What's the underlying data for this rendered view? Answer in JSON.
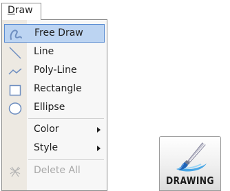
{
  "menu": {
    "title_accel": "D",
    "title_rest": "raw",
    "items": [
      {
        "label": "Free Draw",
        "icon": "free-draw-icon",
        "selected": true
      },
      {
        "label": "Line",
        "icon": "line-icon"
      },
      {
        "label": "Poly-Line",
        "icon": "polyline-icon"
      },
      {
        "label": "Rectangle",
        "icon": "rectangle-icon"
      },
      {
        "label": "Ellipse",
        "icon": "ellipse-icon"
      },
      {
        "label": "Color",
        "submenu": true
      },
      {
        "label": "Style",
        "submenu": true
      },
      {
        "label": "Delete All",
        "icon": "delete-all-icon",
        "disabled": true
      }
    ]
  },
  "toolbar": {
    "drawing_label": "DRAWING",
    "icon": "paintbrush-icon"
  },
  "colors": {
    "selection_fill": "#bcd4f2",
    "selection_border": "#5a8cd2",
    "icon_blue": "#6e8ec0",
    "disabled_text": "#a8a8a8"
  }
}
